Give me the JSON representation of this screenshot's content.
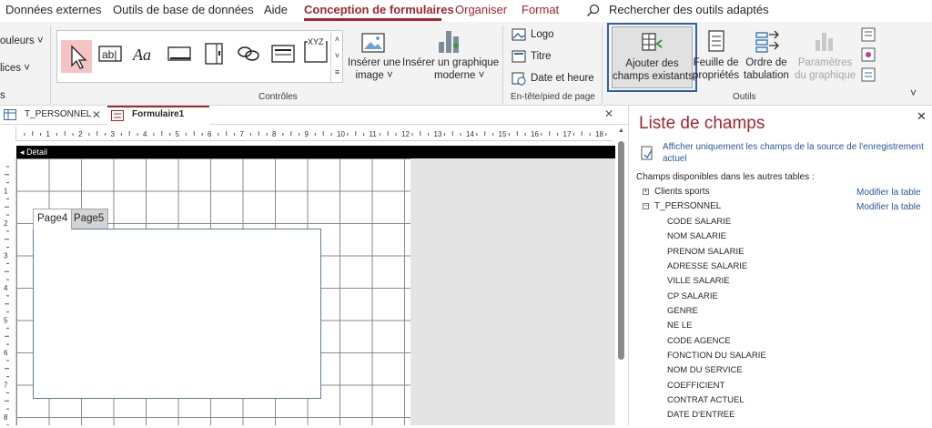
{
  "ribbon_tabs": [
    {
      "label": "Données externes"
    },
    {
      "label": "Outils de base de données"
    },
    {
      "label": "Aide"
    },
    {
      "label": "Conception de formulaires"
    },
    {
      "label": "Organiser"
    },
    {
      "label": "Format"
    }
  ],
  "search": {
    "label": "Rechercher des outils adaptés"
  },
  "left_cut": {
    "couleurs": "ouleurs",
    "polices": "lices"
  },
  "groups": {
    "controles": "Contrôles",
    "entete": "En-tête/pied de page",
    "outils": "Outils"
  },
  "insert": {
    "image": "Insérer une",
    "image2": "image",
    "graph": "Insérer un graphique",
    "graph2": "moderne"
  },
  "header_footer": {
    "logo": "Logo",
    "titre": "Titre",
    "date": "Date et heure"
  },
  "tools": {
    "add_fields_1": "Ajouter des",
    "add_fields_2": "champs existants",
    "props_1": "Feuille de",
    "props_2": "propriétés",
    "order_1": "Ordre de",
    "order_2": "tabulation",
    "chart_1": "Paramètres",
    "chart_2": "du graphique"
  },
  "doc_tabs": [
    {
      "label": "T_PERSONNEL"
    },
    {
      "label": "Formulaire1"
    }
  ],
  "ruler_numbers": [
    "1",
    "2",
    "3",
    "4",
    "5",
    "6",
    "7",
    "8",
    "9",
    "10",
    "11",
    "12",
    "13",
    "14",
    "15",
    "16",
    "17",
    "18"
  ],
  "vruler_numbers": [
    "1",
    "2",
    "3",
    "4",
    "5",
    "6",
    "7",
    "8"
  ],
  "detail_label": "Détail",
  "page_tabs": {
    "page4": "Page4",
    "page5": "Page5"
  },
  "field_list": {
    "title": "Liste de champs",
    "show_only": "Afficher uniquement les champs de la source de l'enregistrement",
    "show_only_2": "actuel",
    "available": "Champs disponibles dans les autres tables :",
    "tables": [
      {
        "name": "Clients sports",
        "edit": "Modifier la table",
        "expanded": false
      },
      {
        "name": "T_PERSONNEL",
        "edit": "Modifier la table",
        "expanded": true
      }
    ],
    "fields": [
      "CODE SALARIE",
      "NOM SALARIE",
      "PRENOM SALARIE",
      "ADRESSE SALARIE",
      "VILLE SALARIE",
      "CP SALARIE",
      "GENRE",
      "NE LE",
      "CODE AGENCE",
      "FONCTION DU SALARIE",
      "NOM DU SERVICE",
      "COEFFICIENT",
      "CONTRAT ACTUEL",
      "DATE D'ENTREE"
    ]
  },
  "colors": {
    "accent": "#a4262c",
    "highlight": "#2e5fa8",
    "link": "#2b579a"
  }
}
